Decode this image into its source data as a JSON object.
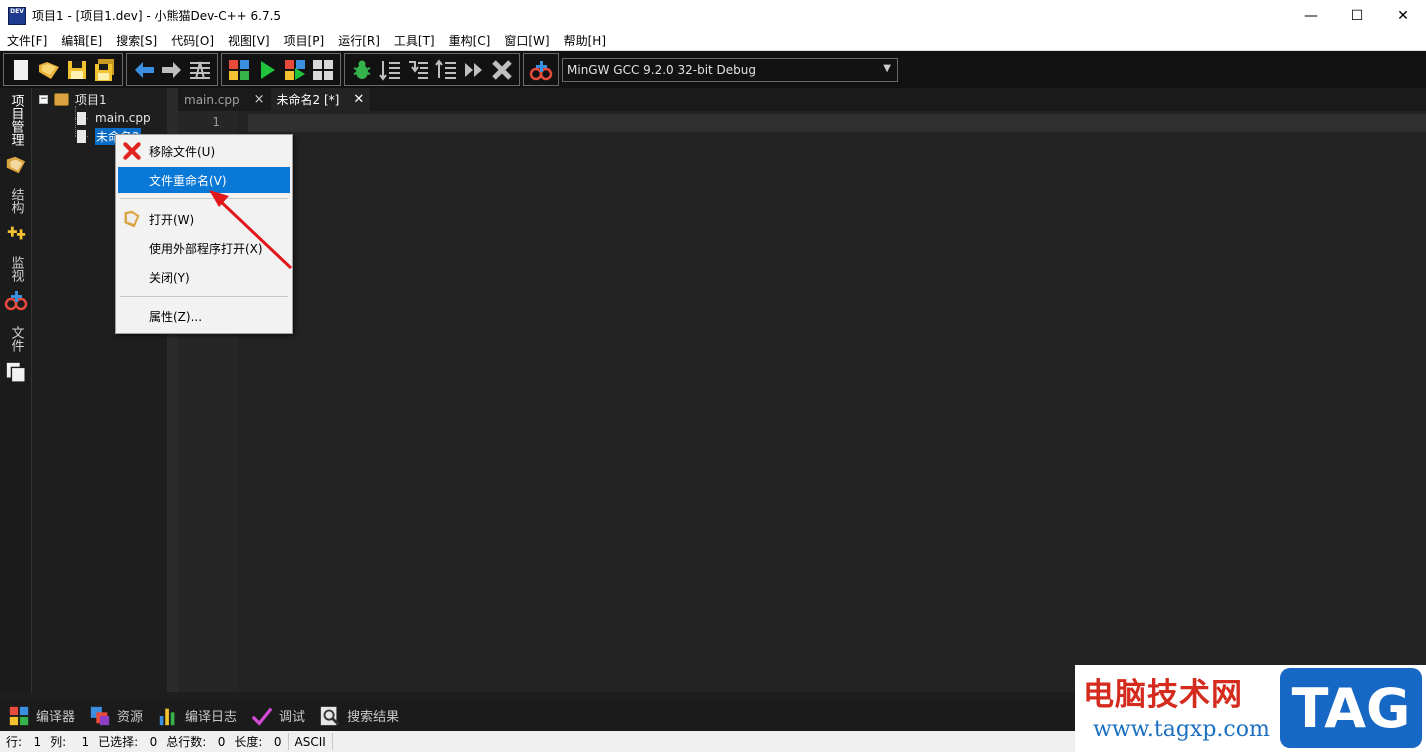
{
  "window": {
    "title": "项目1 - [项目1.dev] - 小熊猫Dev-C++ 6.7.5",
    "app_icon_text": "DEV",
    "minimize": "—",
    "maximize": "☐",
    "close": "✕"
  },
  "menu": [
    "文件[F]",
    "编辑[E]",
    "搜索[S]",
    "代码[O]",
    "视图[V]",
    "项目[P]",
    "运行[R]",
    "工具[T]",
    "重构[C]",
    "窗口[W]",
    "帮助[H]"
  ],
  "toolbar": {
    "compiler": "MinGW GCC 9.2.0 32-bit Debug"
  },
  "side_tabs": {
    "project": "项目管理",
    "structure": "结构",
    "watch": "监视",
    "files": "文件"
  },
  "project_tree": {
    "root": "项目1",
    "files": [
      "main.cpp",
      "未命名2"
    ]
  },
  "editor": {
    "tabs": [
      {
        "label": "main.cpp",
        "close": "×"
      },
      {
        "label": "未命名2 [*]",
        "close": "✕"
      }
    ],
    "line_number": "1"
  },
  "context_menu": {
    "remove": "移除文件(U)",
    "rename": "文件重命名(V)",
    "open": "打开(W)",
    "open_external": "使用外部程序打开(X)",
    "close": "关闭(Y)",
    "properties": "属性(Z)..."
  },
  "bottom_tabs": [
    "编译器",
    "资源",
    "编译日志",
    "调试",
    "搜索结果"
  ],
  "status": {
    "line_label": "行:",
    "line_value": "1",
    "col_label": "列:",
    "col_value": "1",
    "sel_label": "已选择:",
    "sel_value": "0",
    "total_label": "总行数:",
    "total_value": "0",
    "length_label": "长度:",
    "length_value": "0",
    "encoding": "ASCII"
  },
  "watermark": {
    "cn": "电脑技术网",
    "url": "www.tagxp.com",
    "tag": "TAG"
  },
  "colors": {
    "selection": "#0a78d7",
    "arrow": "#e0181b",
    "editor_bg": "#232323"
  }
}
